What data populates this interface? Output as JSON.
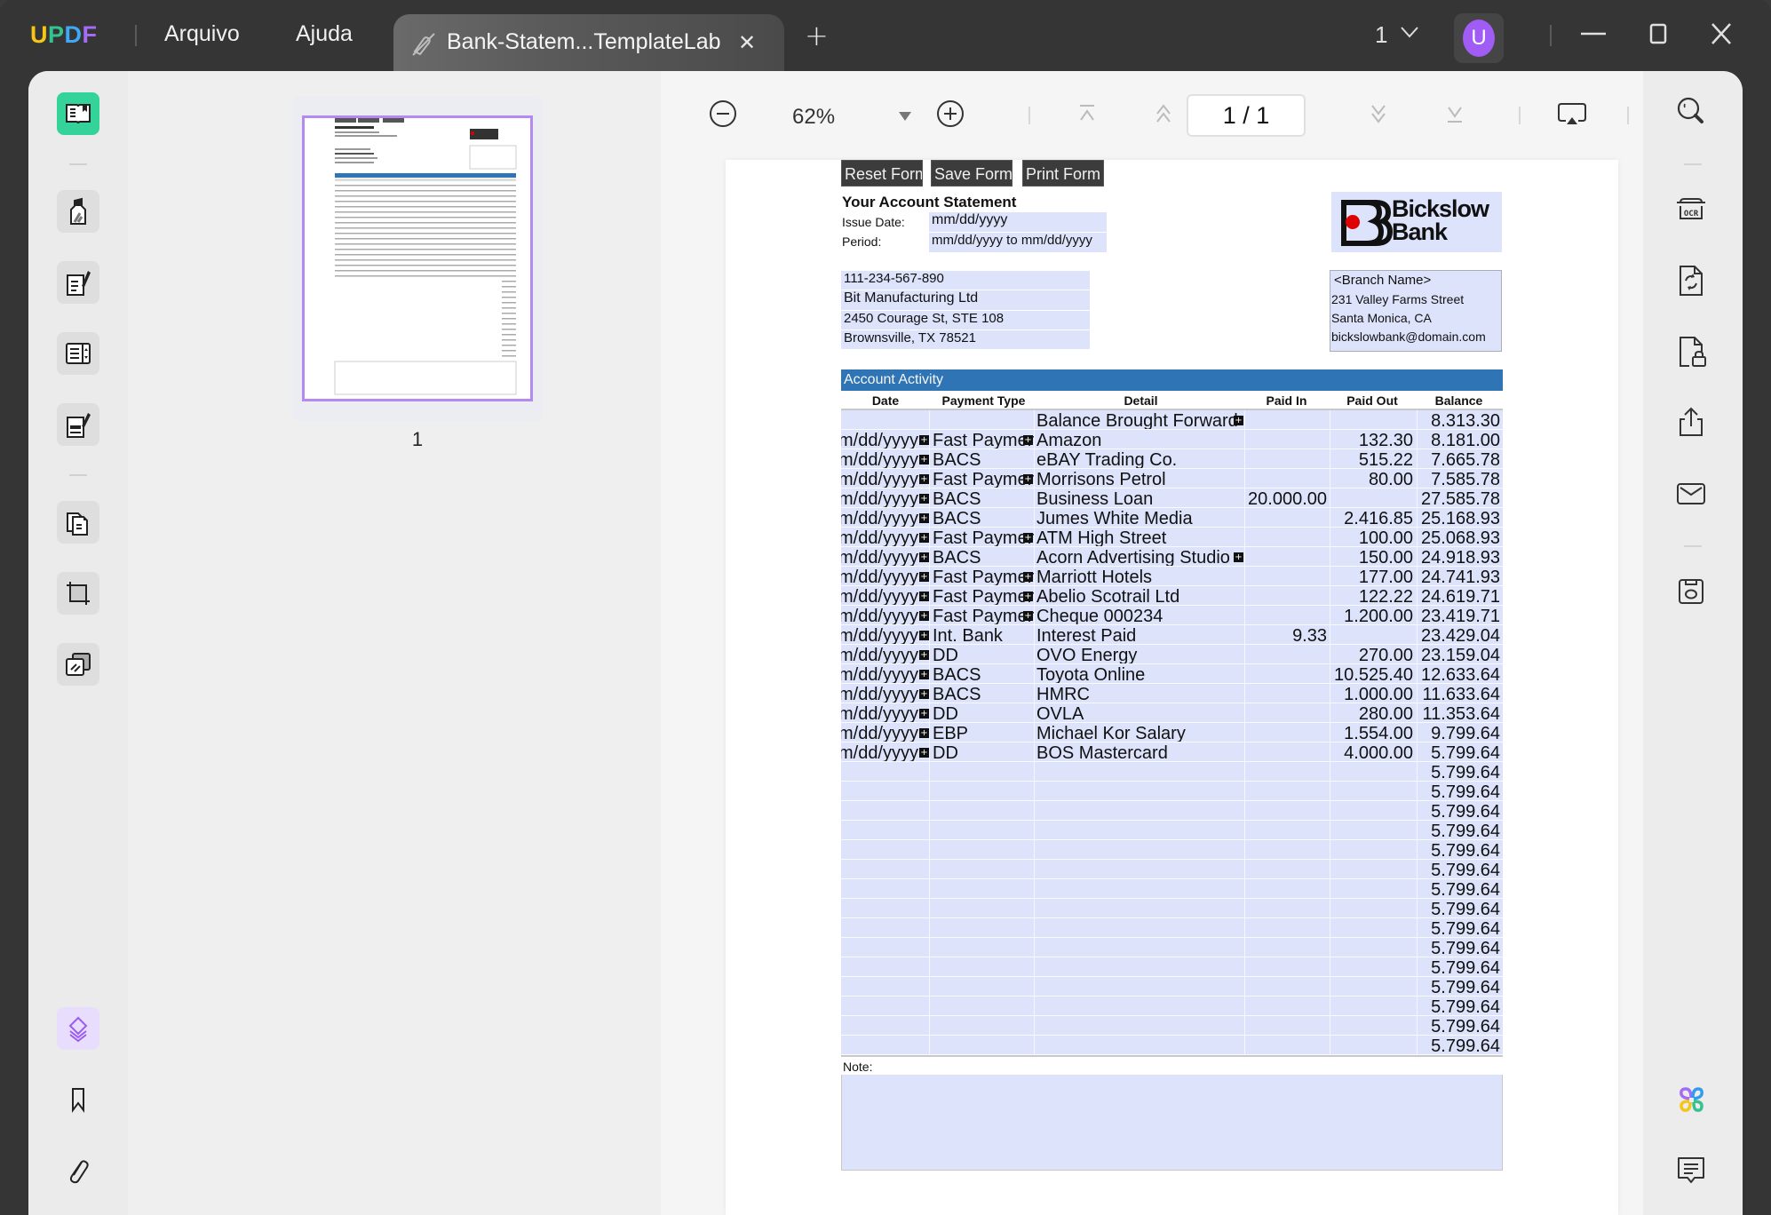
{
  "app": {
    "logo": [
      "U",
      "P",
      "D",
      "F"
    ],
    "menu": [
      "Arquivo",
      "Ajuda"
    ],
    "tab_title": "Bank-Statem...TemplateLab",
    "tab_close": "✕",
    "add_tab": "+",
    "window_count": "1",
    "avatar_initial": "U",
    "accent_color": "#a05cf4"
  },
  "left_rail": {
    "items": [
      {
        "name": "reader",
        "active": true
      },
      {
        "name": "comment"
      },
      {
        "name": "edit-pdf"
      },
      {
        "name": "form"
      },
      {
        "name": "fill-sign"
      },
      {
        "name": "organize-pages"
      },
      {
        "name": "crop"
      },
      {
        "name": "redact"
      },
      {
        "name": "layers",
        "selected": true
      },
      {
        "name": "bookmark"
      },
      {
        "name": "attachment"
      }
    ]
  },
  "thumbnails": {
    "pages": [
      {
        "number": "1",
        "selected": true
      }
    ]
  },
  "toolbar": {
    "zoom": "62%",
    "page_indicator": "1 / 1"
  },
  "document": {
    "form_buttons": [
      "Reset Form",
      "Save Form",
      "Print Form"
    ],
    "title": "Your Account Statement",
    "issue_date_label": "Issue Date:",
    "issue_date_value": "mm/dd/yyyy",
    "period_label": "Period:",
    "period_value": "mm/dd/yyyy to mm/dd/yyyy",
    "account": {
      "number": "111-234-567-890",
      "name": "Bit Manufacturing Ltd",
      "address1": "2450 Courage St, STE 108",
      "address2": "Brownsville, TX 78521"
    },
    "bank": {
      "name_line1": "Bickslow",
      "name_line2": "Bank",
      "branch": "<Branch Name>",
      "street": "231 Valley Farms Street",
      "city": "Santa Monica, CA",
      "email": "bickslowbank@domain.com"
    },
    "activity": {
      "title": "Account Activity",
      "columns": [
        "Date",
        "Payment Type",
        "Detail",
        "Paid In",
        "Paid Out",
        "Balance"
      ],
      "rows": [
        {
          "date": "",
          "type": "",
          "detail": "Balance Brought Forward",
          "in": "",
          "out": "",
          "balance": "8.313.30"
        },
        {
          "date": "mm/dd/yyyy",
          "type": "Fast Payment",
          "detail": "Amazon",
          "in": "",
          "out": "132.30",
          "balance": "8.181.00"
        },
        {
          "date": "mm/dd/yyyy",
          "type": "BACS",
          "detail": "eBAY Trading Co.",
          "in": "",
          "out": "515.22",
          "balance": "7.665.78"
        },
        {
          "date": "mm/dd/yyyy",
          "type": "Fast Payment",
          "detail": "Morrisons Petrol",
          "in": "",
          "out": "80.00",
          "balance": "7.585.78"
        },
        {
          "date": "mm/dd/yyyy",
          "type": "BACS",
          "detail": "Business Loan",
          "in": "20.000.00",
          "out": "",
          "balance": "27.585.78"
        },
        {
          "date": "mm/dd/yyyy",
          "type": "BACS",
          "detail": "Jumes White Media",
          "in": "",
          "out": "2.416.85",
          "balance": "25.168.93"
        },
        {
          "date": "mm/dd/yyyy",
          "type": "Fast Payment",
          "detail": "ATM High Street",
          "in": "",
          "out": "100.00",
          "balance": "25.068.93"
        },
        {
          "date": "mm/dd/yyyy",
          "type": "BACS",
          "detail": "Acorn Advertising Studio",
          "in": "",
          "out": "150.00",
          "balance": "24.918.93"
        },
        {
          "date": "mm/dd/yyyy",
          "type": "Fast Payment",
          "detail": "Marriott Hotels",
          "in": "",
          "out": "177.00",
          "balance": "24.741.93"
        },
        {
          "date": "mm/dd/yyyy",
          "type": "Fast Payment",
          "detail": "Abelio Scotrail Ltd",
          "in": "",
          "out": "122.22",
          "balance": "24.619.71"
        },
        {
          "date": "mm/dd/yyyy",
          "type": "Fast Payment",
          "detail": "Cheque 000234",
          "in": "",
          "out": "1.200.00",
          "balance": "23.419.71"
        },
        {
          "date": "mm/dd/yyyy",
          "type": "Int. Bank",
          "detail": "Interest Paid",
          "in": "9.33",
          "out": "",
          "balance": "23.429.04"
        },
        {
          "date": "mm/dd/yyyy",
          "type": "DD",
          "detail": "OVO Energy",
          "in": "",
          "out": "270.00",
          "balance": "23.159.04"
        },
        {
          "date": "mm/dd/yyyy",
          "type": "BACS",
          "detail": "Toyota Online",
          "in": "",
          "out": "10.525.40",
          "balance": "12.633.64"
        },
        {
          "date": "mm/dd/yyyy",
          "type": "BACS",
          "detail": "HMRC",
          "in": "",
          "out": "1.000.00",
          "balance": "11.633.64"
        },
        {
          "date": "mm/dd/yyyy",
          "type": "DD",
          "detail": "OVLA",
          "in": "",
          "out": "280.00",
          "balance": "11.353.64"
        },
        {
          "date": "mm/dd/yyyy",
          "type": "EBP",
          "detail": "Michael Kor Salary",
          "in": "",
          "out": "1.554.00",
          "balance": "9.799.64"
        },
        {
          "date": "mm/dd/yyyy",
          "type": "DD",
          "detail": "BOS Mastercard",
          "in": "",
          "out": "4.000.00",
          "balance": "5.799.64"
        },
        {
          "date": "",
          "type": "",
          "detail": "",
          "in": "",
          "out": "",
          "balance": "5.799.64"
        },
        {
          "date": "",
          "type": "",
          "detail": "",
          "in": "",
          "out": "",
          "balance": "5.799.64"
        },
        {
          "date": "",
          "type": "",
          "detail": "",
          "in": "",
          "out": "",
          "balance": "5.799.64"
        },
        {
          "date": "",
          "type": "",
          "detail": "",
          "in": "",
          "out": "",
          "balance": "5.799.64"
        },
        {
          "date": "",
          "type": "",
          "detail": "",
          "in": "",
          "out": "",
          "balance": "5.799.64"
        },
        {
          "date": "",
          "type": "",
          "detail": "",
          "in": "",
          "out": "",
          "balance": "5.799.64"
        },
        {
          "date": "",
          "type": "",
          "detail": "",
          "in": "",
          "out": "",
          "balance": "5.799.64"
        },
        {
          "date": "",
          "type": "",
          "detail": "",
          "in": "",
          "out": "",
          "balance": "5.799.64"
        },
        {
          "date": "",
          "type": "",
          "detail": "",
          "in": "",
          "out": "",
          "balance": "5.799.64"
        },
        {
          "date": "",
          "type": "",
          "detail": "",
          "in": "",
          "out": "",
          "balance": "5.799.64"
        },
        {
          "date": "",
          "type": "",
          "detail": "",
          "in": "",
          "out": "",
          "balance": "5.799.64"
        },
        {
          "date": "",
          "type": "",
          "detail": "",
          "in": "",
          "out": "",
          "balance": "5.799.64"
        },
        {
          "date": "",
          "type": "",
          "detail": "",
          "in": "",
          "out": "",
          "balance": "5.799.64"
        },
        {
          "date": "",
          "type": "",
          "detail": "",
          "in": "",
          "out": "",
          "balance": "5.799.64"
        },
        {
          "date": "",
          "type": "",
          "detail": "",
          "in": "",
          "out": "",
          "balance": "5.799.64"
        }
      ]
    },
    "note_label": "Note:"
  },
  "right_rail": {
    "items": [
      "search",
      "ocr",
      "convert",
      "protect",
      "share",
      "email",
      "save",
      "ai-assistant",
      "comments"
    ]
  }
}
